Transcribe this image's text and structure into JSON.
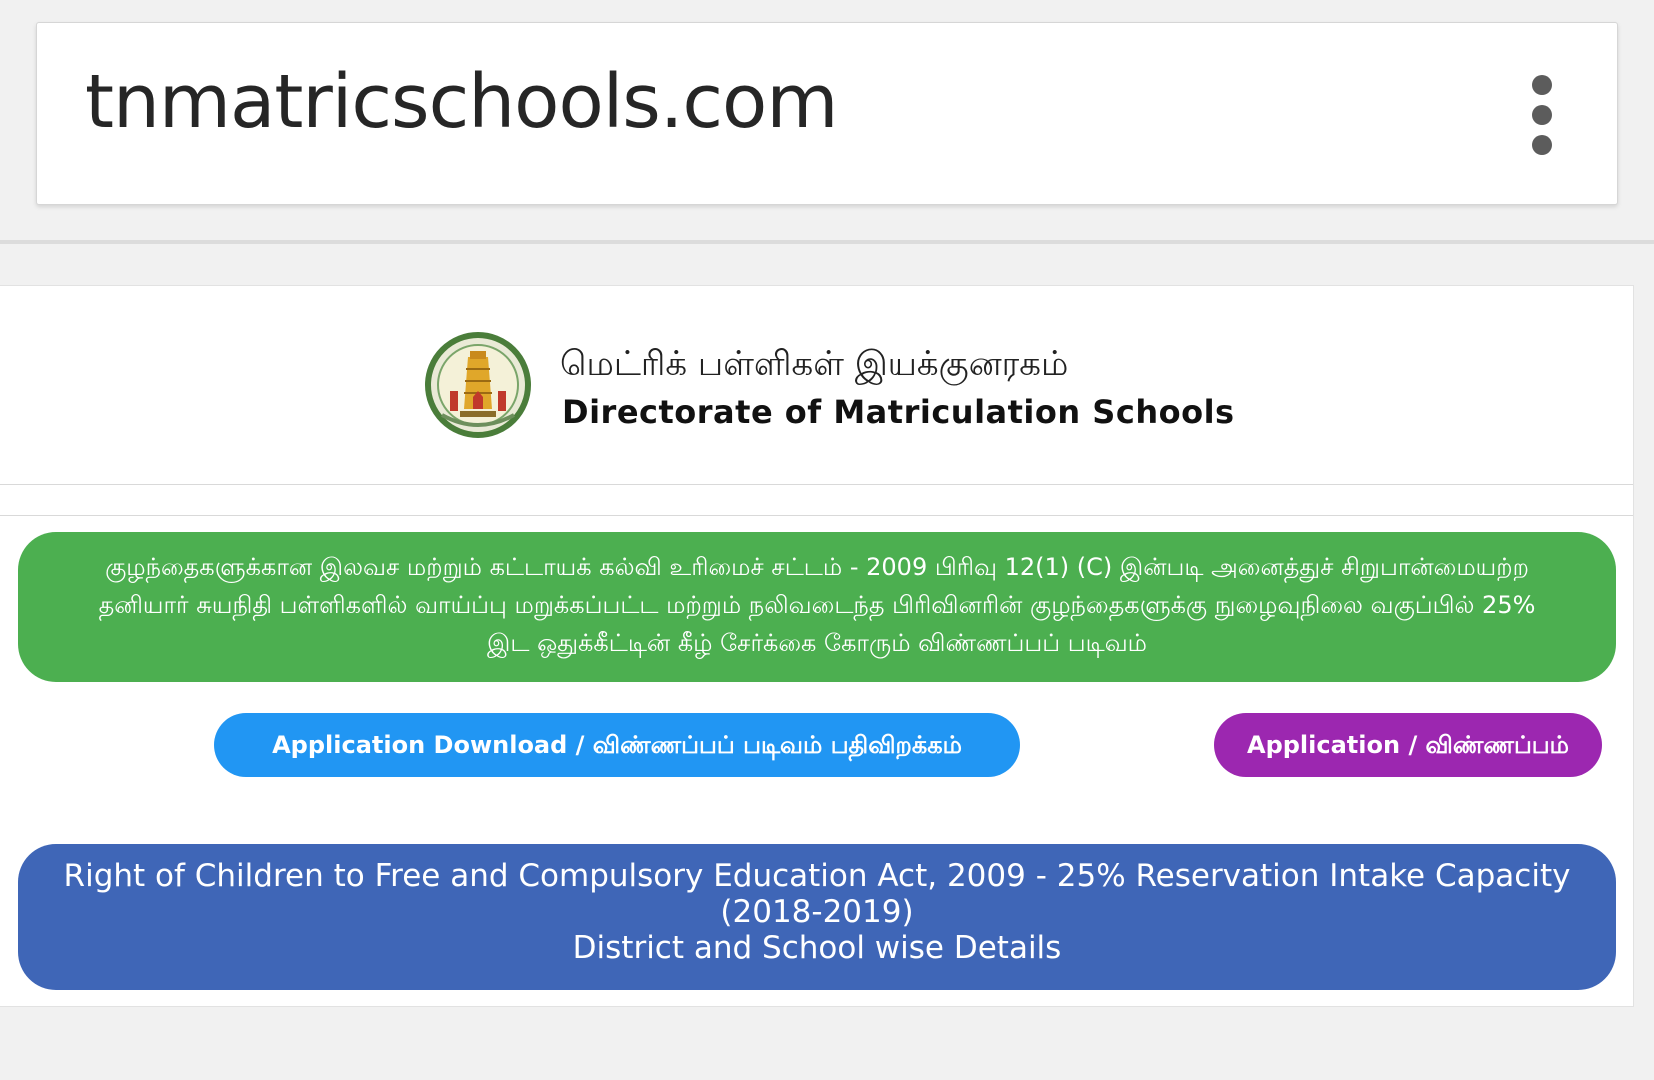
{
  "browser": {
    "url": "tnmatricschools.com",
    "menu_icon": "more-vert-icon"
  },
  "header": {
    "emblem_icon": "tamil-nadu-emblem-icon",
    "title_tamil": "மெட்ரிக் பள்ளிகள் இயக்குனரகம்",
    "title_english": "Directorate of Matriculation Schools"
  },
  "notice": {
    "text": "குழந்தைகளுக்கான இலவச மற்றும் கட்டாயக் கல்வி உரிமைச் சட்டம் - 2009 பிரிவு 12(1) (C) இன்படி அனைத்துச் சிறுபான்மையற்ற தனியார் சுயநிதி பள்ளிகளில் வாய்ப்பு மறுக்கப்பட்ட மற்றும் நலிவடைந்த பிரிவினரின் குழந்தைகளுக்கு நுழைவுநிலை வகுப்பில் 25% இட ஒதுக்கீட்டின் கீழ் சேர்க்கை கோரும் விண்ணப்பப் படிவம்"
  },
  "buttons": {
    "download_label": "Application Download / விண்ணப்பப் படிவம் பதிவிறக்கம்",
    "application_label": "Application / விண்ணப்பம்"
  },
  "intake": {
    "line1": "Right of Children to Free and Compulsory Education Act, 2009 - 25% Reservation Intake Capacity (2018-2019)",
    "line2": "District and School wise Details"
  },
  "colors": {
    "green": "#4caf50",
    "blue_button": "#2196f3",
    "purple_button": "#9c27b0",
    "indigo_banner": "#3f66b7"
  }
}
